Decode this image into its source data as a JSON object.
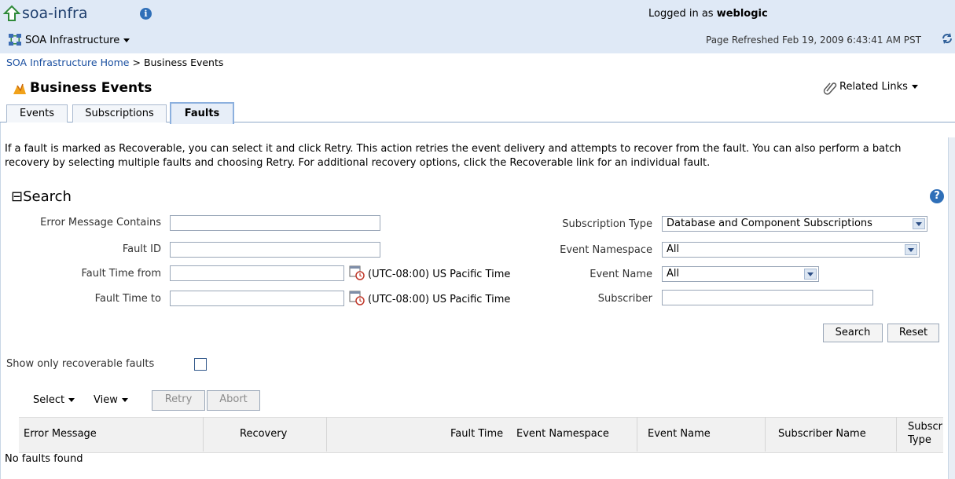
{
  "header": {
    "app_title": "soa-infra",
    "menu_label": "SOA Infrastructure",
    "logged_in_prefix": "Logged in as",
    "logged_in_user": "weblogic",
    "refreshed": "Page Refreshed Feb 19, 2009 6:43:41 AM PST"
  },
  "breadcrumb": {
    "home": "SOA Infrastructure Home",
    "sep": ">",
    "current": "Business Events"
  },
  "page": {
    "title": "Business Events",
    "related_links": "Related Links"
  },
  "tabs": [
    {
      "label": "Events"
    },
    {
      "label": "Subscriptions"
    },
    {
      "label": "Faults"
    }
  ],
  "description": "If a fault is marked as Recoverable, you can select it and click Retry. This action retries the event delivery and attempts to recover from the fault. You can also perform a batch recovery by selecting multiple faults and choosing Retry. For additional recovery options, click the Recoverable link for an individual fault.",
  "search": {
    "heading": "Search",
    "collapse_glyph": "⊟",
    "fields": {
      "error_message_label": "Error Message Contains",
      "fault_id_label": "Fault ID",
      "fault_time_from_label": "Fault Time from",
      "fault_time_to_label": "Fault Time to",
      "timezone": "(UTC-08:00) US Pacific Time",
      "subscription_type_label": "Subscription Type",
      "subscription_type_value": "Database and Component Subscriptions",
      "event_namespace_label": "Event Namespace",
      "event_namespace_value": "All",
      "event_name_label": "Event Name",
      "event_name_value": "All",
      "subscriber_label": "Subscriber"
    },
    "search_button": "Search",
    "reset_button": "Reset"
  },
  "recoverable_filter": "Show only recoverable faults",
  "toolbar": {
    "select": "Select",
    "view": "View",
    "retry": "Retry",
    "abort": "Abort"
  },
  "table": {
    "columns": [
      "Error Message",
      "Recovery",
      "Fault Time",
      "Event Namespace",
      "Event Name",
      "Subscriber Name",
      "Subscr",
      "Type"
    ],
    "empty": "No faults found"
  },
  "colors": {
    "header_bg": "#dfe9f6",
    "link": "#1a4fa0",
    "accent": "#2f6fb8"
  }
}
